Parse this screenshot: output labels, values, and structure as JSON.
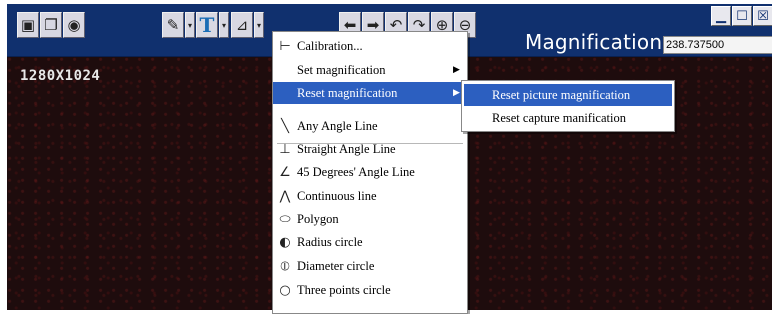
{
  "toolbar": {
    "resolution": "1280X1024",
    "magnification_label": "Magnification",
    "magnification_value": "238.737500",
    "dropdown_arrow": "▾"
  },
  "window_controls": {
    "minimize": "▁",
    "maximize": "☐",
    "close": "☒"
  },
  "menu": {
    "items": [
      {
        "icon": "⊢",
        "label": "Calibration...",
        "submenu": false
      },
      {
        "icon": "",
        "label": "Set magnification",
        "submenu": true
      },
      {
        "icon": "",
        "label": "Reset magnification",
        "submenu": true
      },
      {
        "icon": "╲",
        "label": "Any Angle Line",
        "submenu": false
      },
      {
        "icon": "⊥",
        "label": "Straight Angle Line",
        "submenu": false
      },
      {
        "icon": "∠",
        "label": "45 Degrees' Angle Line",
        "submenu": false
      },
      {
        "icon": "⋀",
        "label": "Continuous line",
        "submenu": false
      },
      {
        "icon": "⬭",
        "label": "Polygon",
        "submenu": false
      },
      {
        "icon": "◐",
        "label": "Radius circle",
        "submenu": false
      },
      {
        "icon": "⦶",
        "label": "Diameter circle",
        "submenu": false
      },
      {
        "icon": "○",
        "label": "Three points circle",
        "submenu": false
      }
    ],
    "arrow": "▶"
  },
  "submenu": {
    "items": [
      "Reset picture magnification",
      "Reset capture manification"
    ]
  },
  "colors": {
    "toolbar": "#10306e",
    "highlight": "#2c5fc0",
    "canvas": "#1e0c0d"
  }
}
